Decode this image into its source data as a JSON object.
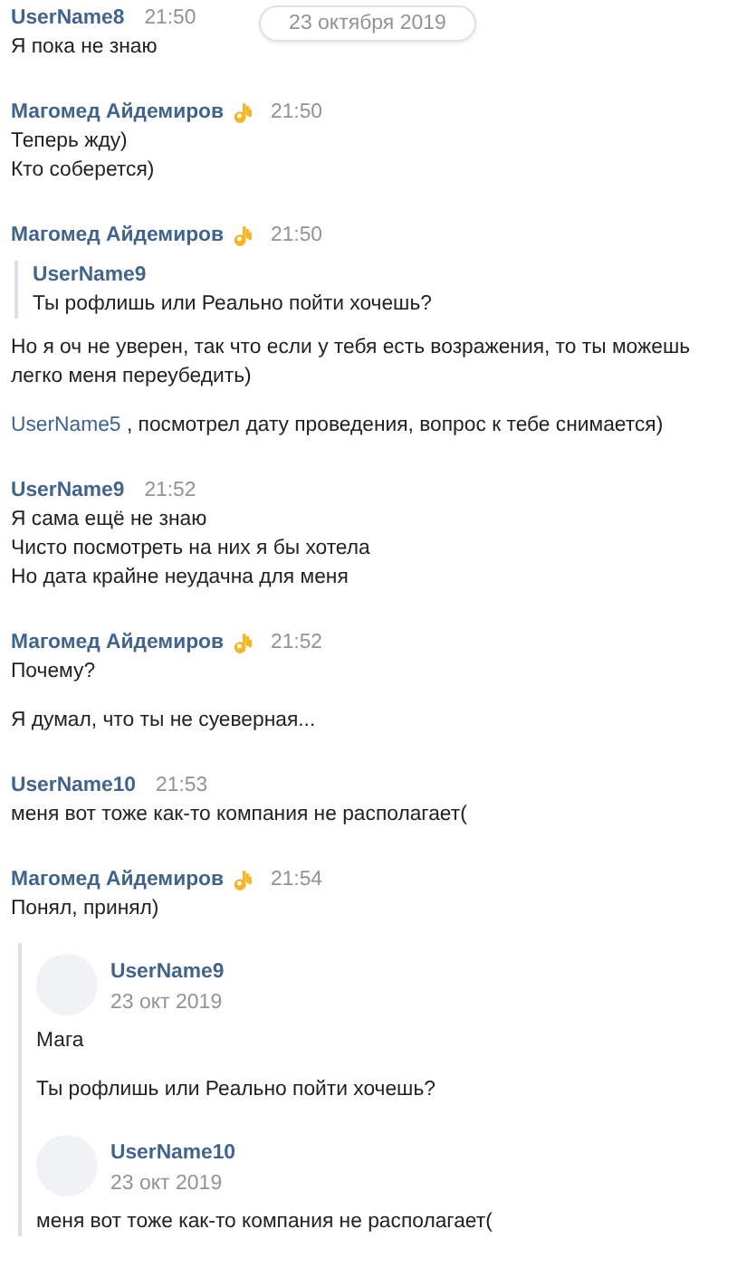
{
  "date_pill": "23 октября 2019",
  "messages": [
    {
      "author": "UserName8",
      "badge": false,
      "time": "21:50",
      "parts": [
        {
          "kind": "text",
          "lines": [
            "Я пока не знаю"
          ]
        }
      ]
    },
    {
      "author": "Магомед Айдемиров",
      "badge": true,
      "time": "21:50",
      "parts": [
        {
          "kind": "text",
          "lines": [
            "Теперь жду)",
            "Кто соберется)"
          ]
        }
      ]
    },
    {
      "author": "Магомед Айдемиров",
      "badge": true,
      "time": "21:50",
      "parts": [
        {
          "kind": "quote",
          "author": "UserName9",
          "lines": [
            "Ты рофлишь или Реально пойти хочешь?"
          ]
        },
        {
          "kind": "text",
          "lines": [
            "Но я оч не уверен, так что если у тебя есть возражения, то ты можешь легко меня переубедить)"
          ]
        },
        {
          "kind": "mention",
          "mention": "UserName5",
          "lines": [
            " , посмотрел дату проведения, вопрос к тебе снимается)"
          ]
        }
      ]
    },
    {
      "author": "UserName9",
      "badge": false,
      "time": "21:52",
      "parts": [
        {
          "kind": "text",
          "lines": [
            "Я сама ещё не знаю",
            "Чисто посмотреть на них я бы хотела",
            "Но дата крайне неудачна для меня"
          ]
        }
      ]
    },
    {
      "author": "Магомед Айдемиров",
      "badge": true,
      "time": "21:52",
      "parts": [
        {
          "kind": "text",
          "lines": [
            "Почему?"
          ]
        },
        {
          "kind": "text",
          "lines": [
            "Я думал, что ты не суеверная..."
          ]
        }
      ]
    },
    {
      "author": "UserName10",
      "badge": false,
      "time": "21:53",
      "parts": [
        {
          "kind": "text",
          "lines": [
            "меня вот тоже как-то компания не располагает("
          ]
        }
      ]
    },
    {
      "author": "Магомед Айдемиров",
      "badge": true,
      "time": "21:54",
      "parts": [
        {
          "kind": "text",
          "lines": [
            "Понял, принял)"
          ]
        },
        {
          "kind": "forward",
          "items": [
            {
              "author": "UserName9",
              "date": "23 окт 2019",
              "paragraphs": [
                "Мага",
                "Ты рофлишь или Реально пойти хочешь?"
              ]
            },
            {
              "author": "UserName10",
              "date": "23 окт 2019",
              "paragraphs": [
                "меня вот тоже как-то компания не располагает("
              ]
            }
          ]
        }
      ]
    }
  ]
}
